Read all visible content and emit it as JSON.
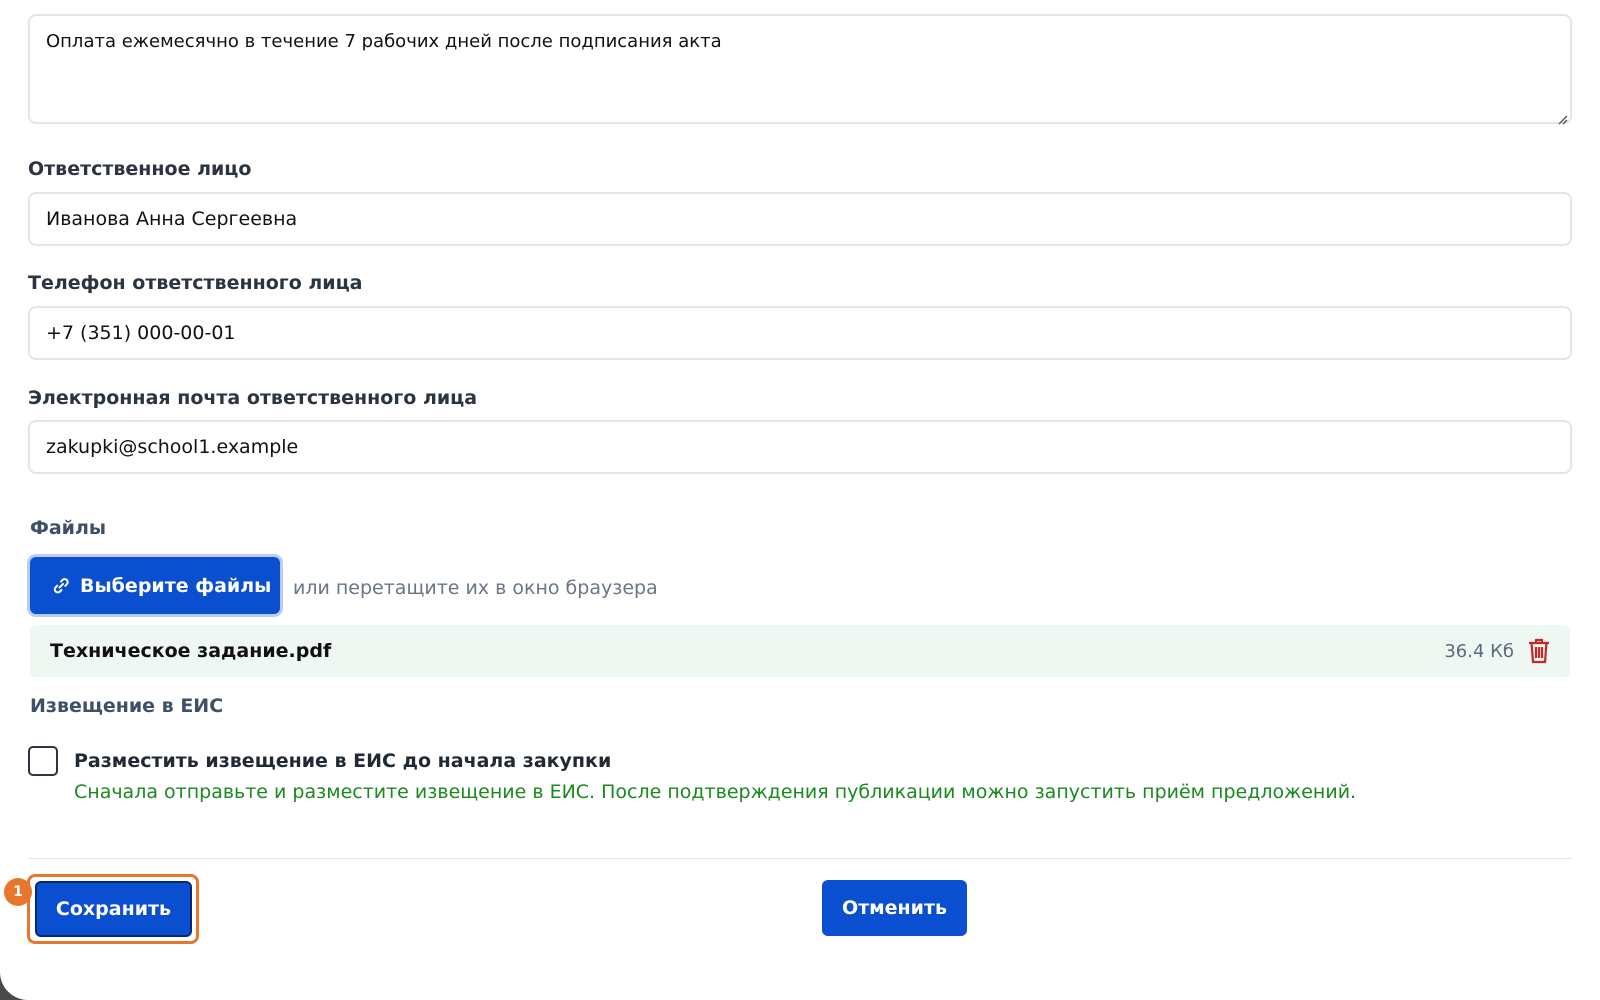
{
  "payment_terms": {
    "value": "Оплата ежемесячно в течение 7 рабочих дней после подписания акта"
  },
  "responsible_person": {
    "label": "Ответственное лицо",
    "value": "Иванова Анна Сергеевна"
  },
  "responsible_phone": {
    "label": "Телефон ответственного лица",
    "value": "+7 (351) 000-00-01"
  },
  "responsible_email": {
    "label": "Электронная почта ответственного лица",
    "value": "zakupki@school1.example"
  },
  "files": {
    "label": "Файлы",
    "choose_button": "Выберите файлы",
    "drop_hint": "или перетащите их в окно браузера",
    "items": [
      {
        "name": "Техническое задание.pdf",
        "size": "36.4 Кб"
      }
    ]
  },
  "eis": {
    "label": "Извещение в ЕИС",
    "checkbox_label": "Разместить извещение в ЕИС до начала закупки",
    "checked": false,
    "hint": "Сначала отправьте и разместите извещение в ЕИС. После подтверждения публикации можно запустить приём предложений."
  },
  "actions": {
    "save": "Сохранить",
    "cancel": "Отменить",
    "save_badge": "1"
  },
  "colors": {
    "primary": "#0a4fcf",
    "highlight": "#e8772e",
    "hint_green": "#198a1e",
    "delete_red": "#c62828"
  },
  "icons": {
    "choose_button": "link-icon",
    "file_delete": "trash-icon",
    "textarea_resize": "resize-handle-icon"
  }
}
